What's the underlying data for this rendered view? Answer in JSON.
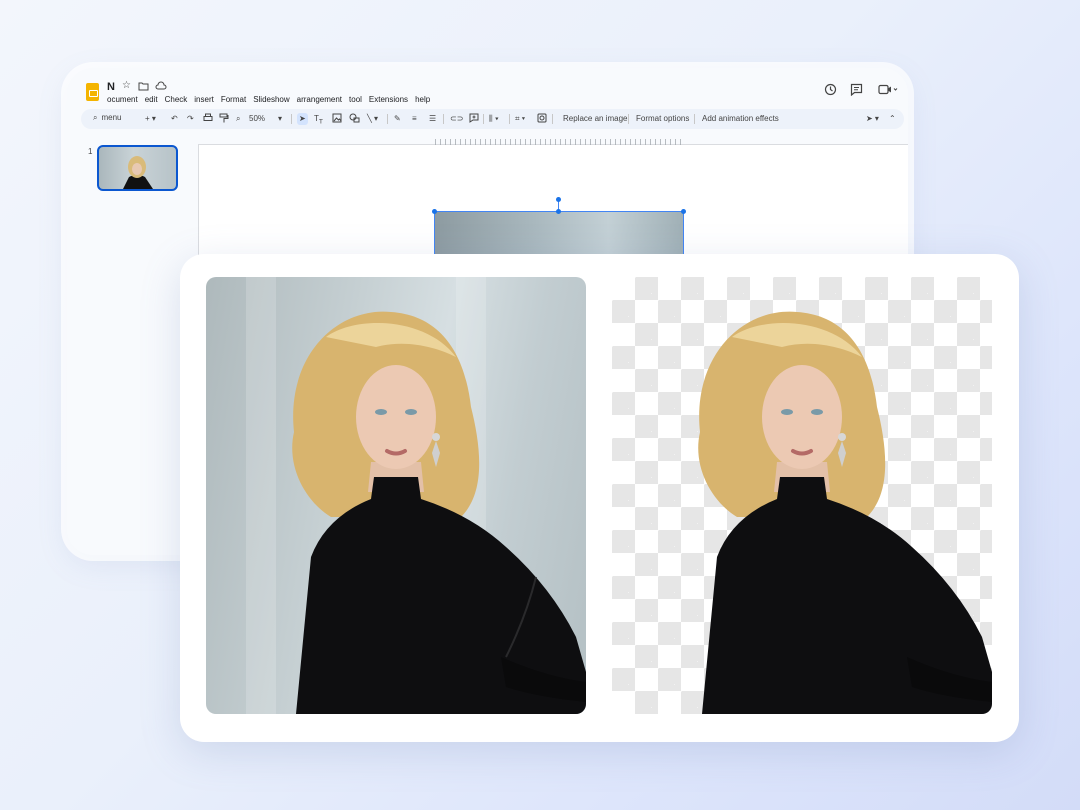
{
  "document": {
    "title": "N",
    "title_icons": [
      "star-icon",
      "folder-move-icon",
      "cloud-status-icon"
    ]
  },
  "menu": [
    "ocument",
    "edit",
    "Check",
    "insert",
    "Format",
    "Slideshow",
    "arrangement",
    "tool",
    "Extensions",
    "help"
  ],
  "top_right_icons": [
    "history-icon",
    "comments-icon",
    "video-call-icon"
  ],
  "toolbar": {
    "search_label": "menu",
    "zoom": "50%",
    "replace_image_label": "Replace an image",
    "format_options_label": "Format options",
    "animation_label": "Add animation effects"
  },
  "slides": {
    "panel_number": "1"
  },
  "colors": {
    "accent": "#0b57d0",
    "selection": "#4285f4",
    "logo": "#f4b400",
    "checker": "#e6e6e6"
  },
  "comparison": {
    "left": "original-photo",
    "right": "background-removed-photo"
  }
}
